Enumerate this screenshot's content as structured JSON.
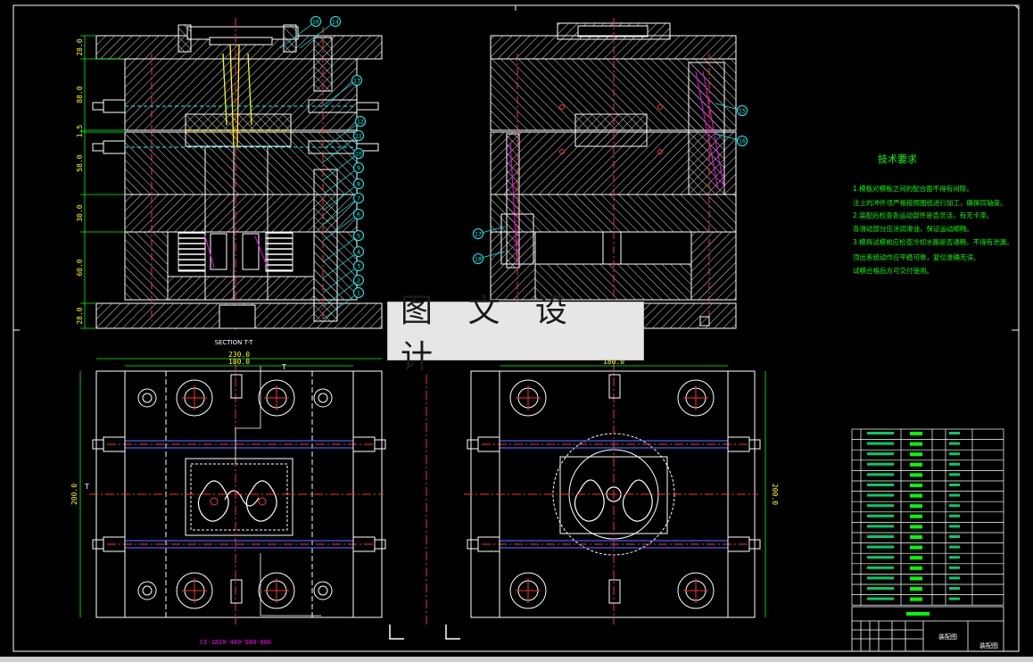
{
  "section_label": "SECTION T-T",
  "watermark": "图 文 设 计",
  "part_number": "CI-1820-440-580-080",
  "tech_title": "技术要求",
  "tech_notes": [
    "1.模板对模板之间的配合面不得有间隙。",
    "注上的冲件须严格按照图纸进行加工，确保同轴度。",
    "2.装配后检查各运动部件是否灵活，有无卡滞。",
    "各滑动部分应涂润滑油，保证运动顺畅。",
    "3.模具试模前应检查冷却水路是否通畅，不得有泄漏。",
    "顶出系统动作应平稳可靠，复位准确无误。",
    "试模合格后方可交付使用。"
  ],
  "vdims_left": [
    "28.0",
    "88.0",
    "1.5",
    "58.0",
    "30.0",
    "60.0",
    "28.0"
  ],
  "dim_top_outer": "230.0",
  "dim_top_inner": "180.0",
  "dim_left_side": "200.0",
  "dim_right_top": "180.0",
  "dim_right_side": "200.0",
  "section_mark": "T",
  "callouts_left": [
    "16",
    "14",
    "13",
    "12",
    "11",
    "10",
    "9",
    "8",
    "7",
    "6",
    "5",
    "4",
    "3",
    "2",
    "1"
  ],
  "callouts_right": [
    "15",
    "16",
    "17",
    "18"
  ],
  "bom_rows": 17,
  "title_block": {
    "name": "装配图",
    "label": "装配图"
  },
  "colors": {
    "bg": "#000000",
    "white": "#ffffff",
    "yellow": "#ffff00",
    "green": "#00ff00",
    "red": "#ff3030",
    "cyan": "#00ffff",
    "blue": "#4060ff",
    "magenta": "#ff00ff"
  }
}
